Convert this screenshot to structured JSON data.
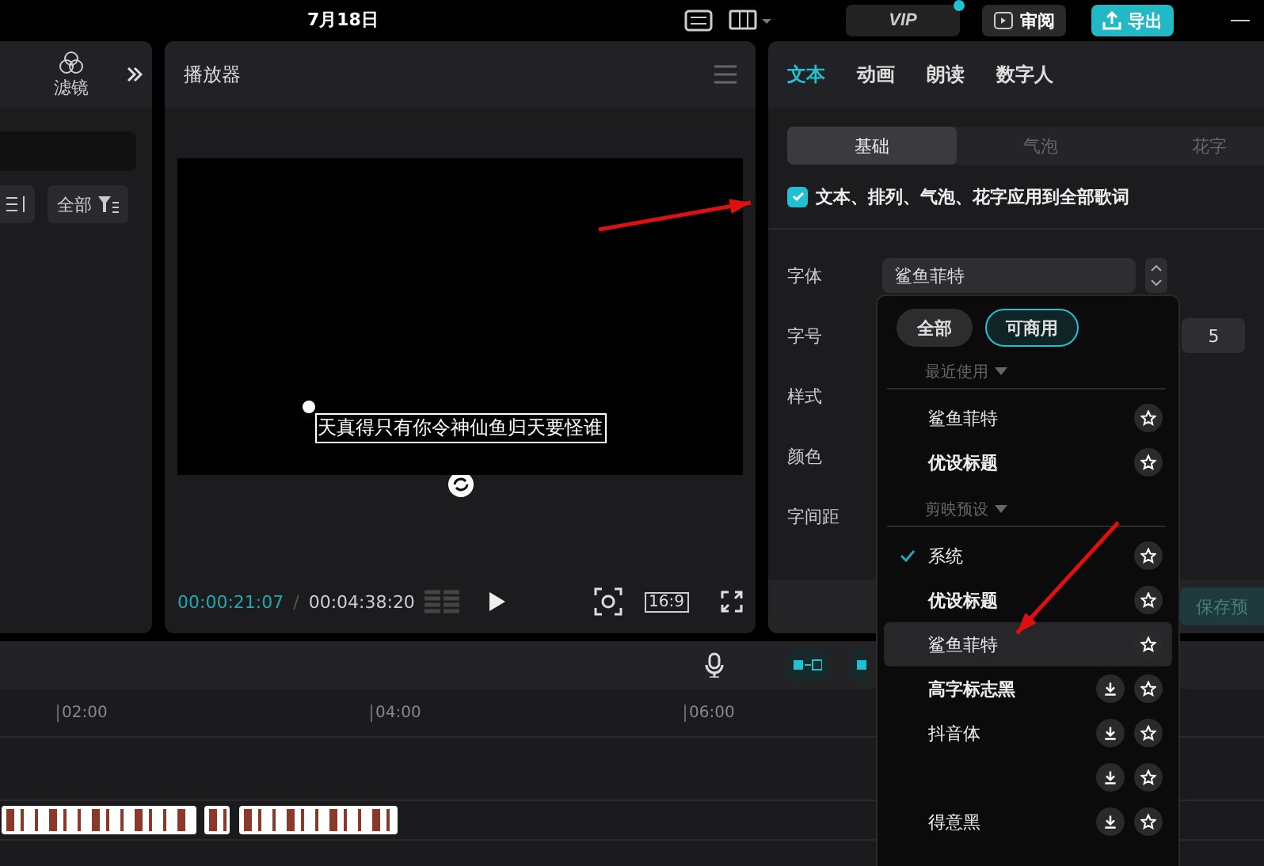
{
  "title_bar": {
    "title": "7月18日",
    "vip": "VIP",
    "review": "审阅",
    "export": "导出"
  },
  "left_panel": {
    "tab": "滤镜",
    "sort_filter": "全部"
  },
  "player": {
    "title": "播放器",
    "subtitle": "天真得只有你令神仙鱼归天要怪谁",
    "current_time": "00:00:21:07",
    "separator": "/",
    "total_time": "00:04:38:20",
    "ratio": "16:9"
  },
  "inspector": {
    "tabs": [
      {
        "label": "文本",
        "selected": true
      },
      {
        "label": "动画",
        "selected": false
      },
      {
        "label": "朗读",
        "selected": false
      },
      {
        "label": "数字人",
        "selected": false
      }
    ],
    "subtabs": [
      {
        "label": "基础",
        "selected": true
      },
      {
        "label": "气泡",
        "selected": false
      },
      {
        "label": "花字",
        "selected": false
      }
    ],
    "apply_all": {
      "label": "文本、排列、气泡、花字应用到全部歌词",
      "checked": true
    },
    "rows": [
      {
        "label": "字体",
        "kind": "select",
        "value": "鲨鱼菲特"
      },
      {
        "label": "字号",
        "kind": "number",
        "value": "5"
      },
      {
        "label": "样式",
        "kind": "blank"
      },
      {
        "label": "颜色",
        "kind": "blank"
      },
      {
        "label": "字间距",
        "kind": "blank"
      }
    ],
    "save_preset": "保存预"
  },
  "font_menu": {
    "filters": [
      {
        "label": "全部",
        "selected": false
      },
      {
        "label": "可商用",
        "selected": true
      }
    ],
    "sections": [
      {
        "title": "最近使用",
        "items": [
          {
            "name": "鲨鱼菲特",
            "checked": false,
            "hovered": false,
            "download": false
          },
          {
            "name": "优设标题",
            "checked": false,
            "hovered": false,
            "download": false
          }
        ]
      },
      {
        "title": "剪映预设",
        "items": [
          {
            "name": "系统",
            "checked": true,
            "hovered": false,
            "download": false
          },
          {
            "name": "优设标题",
            "checked": false,
            "hovered": false,
            "download": false
          },
          {
            "name": "鲨鱼菲特",
            "checked": false,
            "hovered": true,
            "download": false
          },
          {
            "name": "高字标志黑",
            "checked": false,
            "hovered": false,
            "download": true
          },
          {
            "name": "抖音体",
            "checked": false,
            "hovered": false,
            "download": true
          },
          {
            "checked": false,
            "hovered": false,
            "download": true
          },
          {
            "name": "得意黑",
            "checked": false,
            "hovered": false,
            "download": true
          }
        ]
      }
    ]
  },
  "timeline": {
    "ruler": [
      "02:00",
      "04:00",
      "06:00"
    ]
  }
}
